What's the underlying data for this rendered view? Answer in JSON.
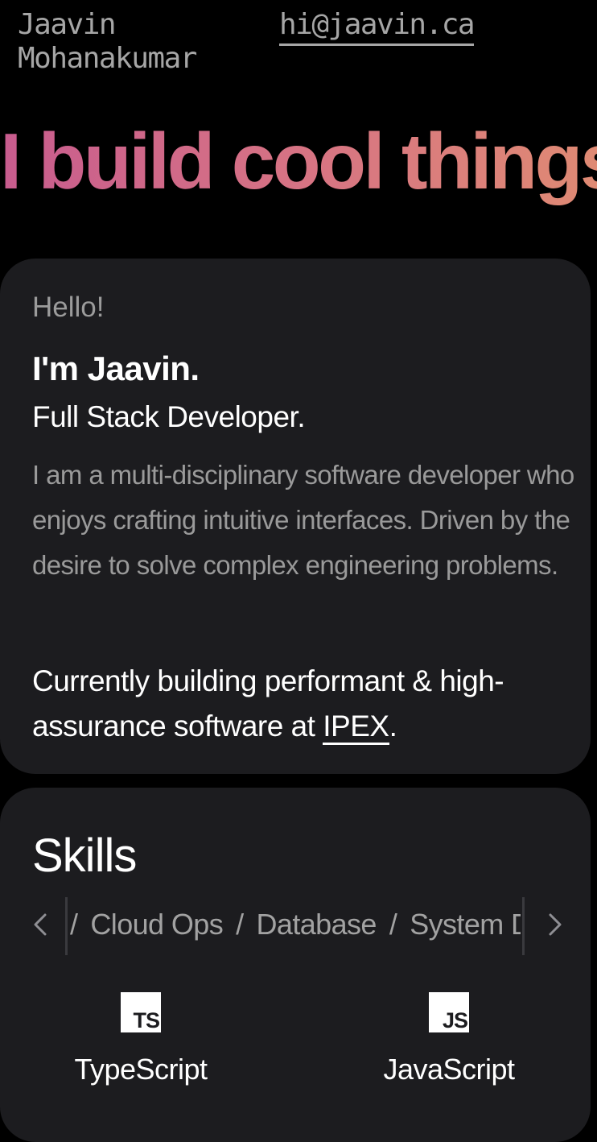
{
  "header": {
    "name": "Jaavin\nMohanakumar",
    "email": "hi@jaavin.ca"
  },
  "hero": {
    "headline": "I build cool things"
  },
  "intro": {
    "greeting": "Hello!",
    "name_line": "I'm Jaavin.",
    "role": "Full Stack Developer.",
    "bio": "I am a multi-disciplinary software developer who enjoys crafting intuitive interfaces. Driven by the desire to solve complex engineering problems.",
    "current_prefix": "Currently building performant & high-assurance software at ",
    "current_company": "IPEX",
    "current_suffix": "."
  },
  "skills": {
    "title": "Skills",
    "categories": [
      "Cloud Ops",
      "Database",
      "System De"
    ],
    "items": [
      {
        "logo": "TS",
        "label": "TypeScript"
      },
      {
        "logo": "JS",
        "label": "JavaScript"
      }
    ]
  },
  "colors": {
    "background": "#000000",
    "card": "#1c1c1f",
    "gradient_start": "#c85c8e",
    "gradient_end": "#e08c72"
  }
}
